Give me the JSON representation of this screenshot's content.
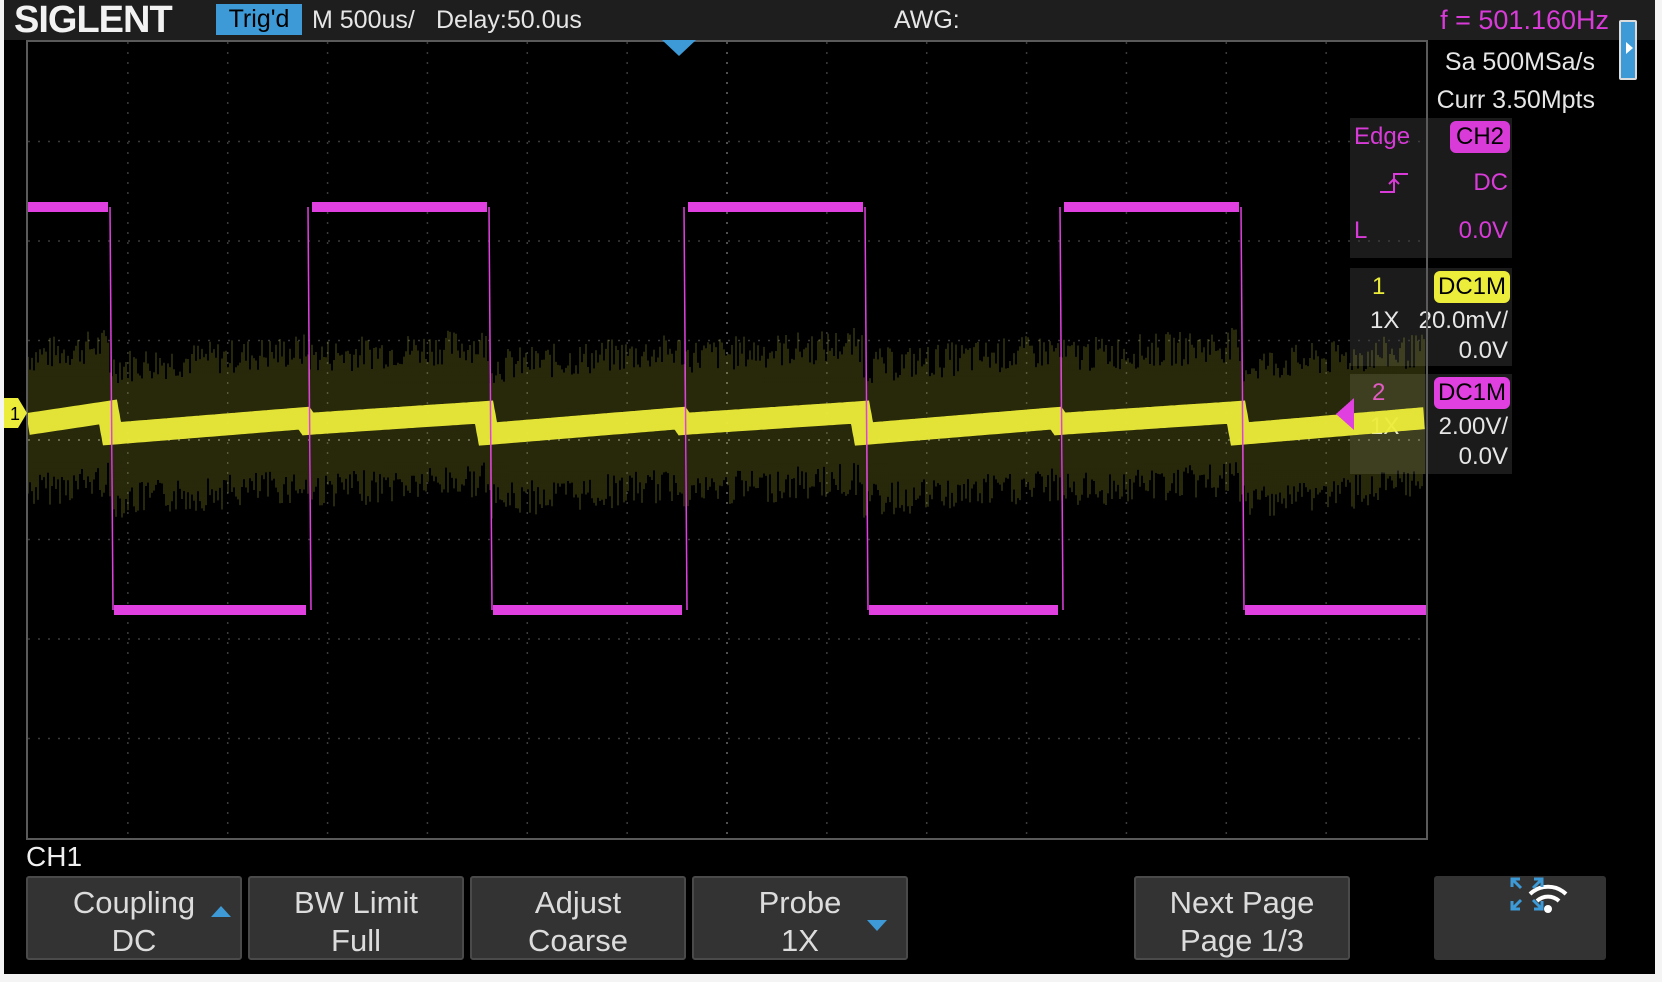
{
  "topbar": {
    "brand": "SIGLENT",
    "trigger_status": "Trig'd",
    "timebase": "M 500us/",
    "delay": "Delay:50.0us",
    "awg": "AWG:",
    "frequency": "f = 501.160Hz"
  },
  "acquisition": {
    "sample_rate": "Sa 500MSa/s",
    "memory": "Curr 3.50Mpts"
  },
  "trigger": {
    "type": "Edge",
    "source": "CH2",
    "coupling": "DC",
    "level_label": "L",
    "level": "0.0V",
    "slope_icon": "rising-edge-icon"
  },
  "channels": [
    {
      "number": "1",
      "coupling": "DC1M",
      "probe": "1X",
      "scale": "20.0mV/",
      "offset": "0.0V",
      "color": "#ecec3a"
    },
    {
      "number": "2",
      "coupling": "DC1M",
      "probe": "1X",
      "scale": "2.00V/",
      "offset": "0.0V",
      "color": "#e040e0"
    }
  ],
  "waveform": {
    "ch1_marker": "1",
    "ch1_color": "#ecec3a",
    "ch2_color": "#e040e0",
    "period_s": 0.001995,
    "ch2_high_fraction": 0.5
  },
  "menu": {
    "channel_label": "CH1",
    "softkeys": [
      {
        "line1": "Coupling",
        "line2": "DC"
      },
      {
        "line1": "BW Limit",
        "line2": "Full"
      },
      {
        "line1": "Adjust",
        "line2": "Coarse"
      },
      {
        "line1": "Probe",
        "line2": "1X"
      },
      {
        "line1": "Next Page",
        "line2": "Page 1/3"
      }
    ]
  },
  "icons": {
    "wifi": "wifi-icon",
    "fullscreen": "fullscreen-icon",
    "trigger_position": "trigger-position-marker-icon"
  },
  "colors": {
    "accent": "#3d9ad6",
    "ch1": "#ecec3a",
    "ch2": "#e040e0",
    "background": "#000000"
  }
}
